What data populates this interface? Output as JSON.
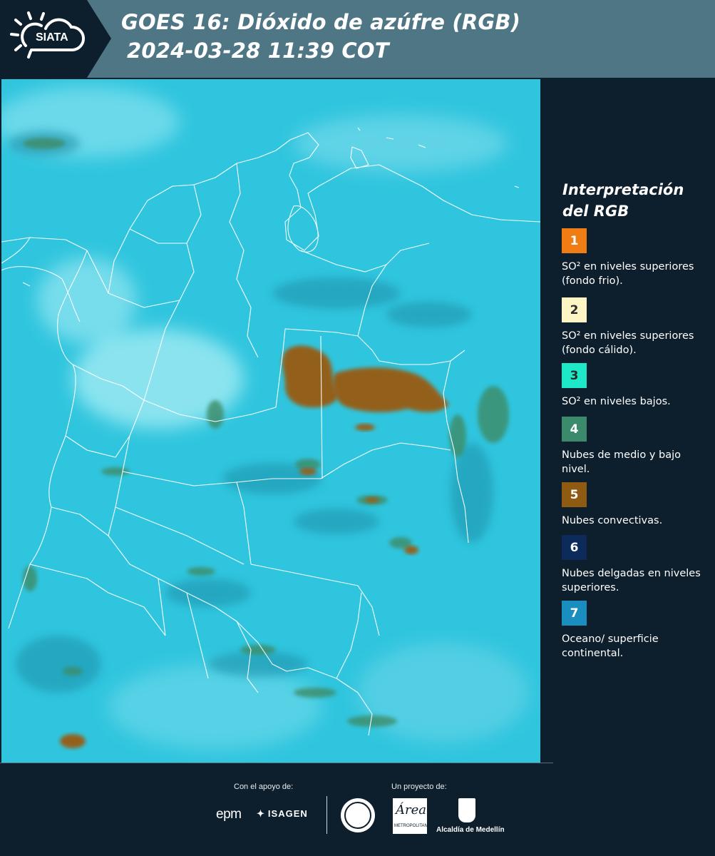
{
  "header": {
    "logo_text": "SIATA",
    "title_line1": "GOES 16: Dióxido de azúfre (RGB)",
    "title_line2": "2024-03-28 11:39 COT",
    "bg_color": "#4f7685"
  },
  "map": {
    "product": "SO2 RGB satellite composite",
    "ocean_color": "#2fc4dd",
    "border_color": "#ffffff"
  },
  "legend": {
    "title_line1": "Interpretación",
    "title_line2": "del RGB",
    "items": [
      {
        "number": "1",
        "color": "#f07d14",
        "text_color": "#ffffff",
        "description": "SO² en niveles superiores (fondo frio)."
      },
      {
        "number": "2",
        "color": "#fdf5c3",
        "text_color": "#2b2b2b",
        "description": "SO² en niveles superiores (fondo cálido)."
      },
      {
        "number": "3",
        "color": "#1de9c8",
        "text_color": "#2b2b2b",
        "description": "SO² en niveles bajos."
      },
      {
        "number": "4",
        "color": "#3a8a6b",
        "text_color": "#ffffff",
        "description": "Nubes de medio y bajo nivel."
      },
      {
        "number": "5",
        "color": "#8f5a12",
        "text_color": "#ffffff",
        "description": "Nubes convectivas."
      },
      {
        "number": "6",
        "color": "#0d2b5a",
        "text_color": "#ffffff",
        "description": "Nubes delgadas en niveles superiores."
      },
      {
        "number": "7",
        "color": "#1a8fbf",
        "text_color": "#ffffff",
        "description": "Oceano/ superficie continental."
      }
    ]
  },
  "footer": {
    "support_label": "Con el apoyo de:",
    "project_label": "Un proyecto de:",
    "epm": "epm",
    "isagen": "ISAGEN",
    "area_script": "Área",
    "area_caption": "METROPOLITANA · Valle de Aburrá",
    "alcaldia": "Alcaldía de Medellín"
  }
}
